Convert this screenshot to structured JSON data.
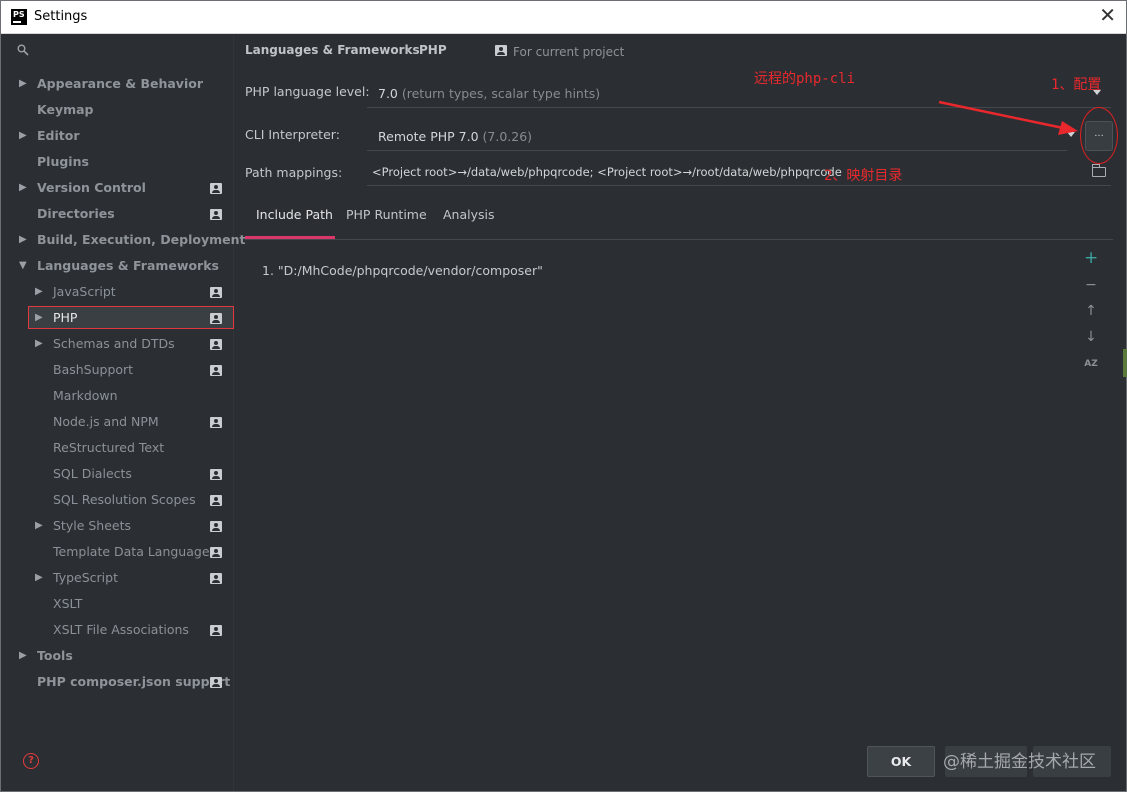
{
  "window": {
    "title": "Settings",
    "app_icon_text": "PS"
  },
  "sidebar": {
    "items": [
      {
        "label": "Appearance & Behavior",
        "level": 0,
        "bold": true,
        "expandable": true,
        "expanded": false,
        "project_icon": false
      },
      {
        "label": "Keymap",
        "level": 0,
        "bold": true,
        "expandable": false,
        "project_icon": false
      },
      {
        "label": "Editor",
        "level": 0,
        "bold": true,
        "expandable": true,
        "expanded": false,
        "project_icon": false
      },
      {
        "label": "Plugins",
        "level": 0,
        "bold": true,
        "expandable": false,
        "project_icon": false
      },
      {
        "label": "Version Control",
        "level": 0,
        "bold": true,
        "expandable": true,
        "expanded": false,
        "project_icon": true
      },
      {
        "label": "Directories",
        "level": 0,
        "bold": true,
        "expandable": false,
        "project_icon": true
      },
      {
        "label": "Build, Execution, Deployment",
        "level": 0,
        "bold": true,
        "expandable": true,
        "expanded": false,
        "project_icon": false
      },
      {
        "label": "Languages & Frameworks",
        "level": 0,
        "bold": true,
        "expandable": true,
        "expanded": true,
        "project_icon": false
      },
      {
        "label": "JavaScript",
        "level": 1,
        "expandable": true,
        "expanded": false,
        "project_icon": true
      },
      {
        "label": "PHP",
        "level": 1,
        "expandable": true,
        "expanded": false,
        "project_icon": true,
        "selected": true
      },
      {
        "label": "Schemas and DTDs",
        "level": 1,
        "expandable": true,
        "expanded": false,
        "project_icon": true
      },
      {
        "label": "BashSupport",
        "level": 1,
        "expandable": false,
        "project_icon": true
      },
      {
        "label": "Markdown",
        "level": 1,
        "expandable": false,
        "project_icon": false
      },
      {
        "label": "Node.js and NPM",
        "level": 1,
        "expandable": false,
        "project_icon": true
      },
      {
        "label": "ReStructured Text",
        "level": 1,
        "expandable": false,
        "project_icon": false
      },
      {
        "label": "SQL Dialects",
        "level": 1,
        "expandable": false,
        "project_icon": true
      },
      {
        "label": "SQL Resolution Scopes",
        "level": 1,
        "expandable": false,
        "project_icon": true
      },
      {
        "label": "Style Sheets",
        "level": 1,
        "expandable": true,
        "expanded": false,
        "project_icon": true
      },
      {
        "label": "Template Data Languages",
        "level": 1,
        "expandable": false,
        "project_icon": true
      },
      {
        "label": "TypeScript",
        "level": 1,
        "expandable": true,
        "expanded": false,
        "project_icon": true
      },
      {
        "label": "XSLT",
        "level": 1,
        "expandable": false,
        "project_icon": false
      },
      {
        "label": "XSLT File Associations",
        "level": 1,
        "expandable": false,
        "project_icon": true
      },
      {
        "label": "Tools",
        "level": 0,
        "bold": true,
        "expandable": true,
        "expanded": false,
        "project_icon": false
      },
      {
        "label": "PHP composer.json support",
        "level": 0,
        "bold": true,
        "expandable": false,
        "project_icon": true
      }
    ]
  },
  "breadcrumb": {
    "parent": "Languages & Frameworks",
    "separator": "›",
    "current": "PHP",
    "scope": "For current project"
  },
  "php_language_level": {
    "label": "PHP language level:",
    "value": "7.0",
    "hint": "(return types, scalar type hints)"
  },
  "cli_interpreter": {
    "label": "CLI Interpreter:",
    "value": "Remote PHP 7.0",
    "hint": "(7.0.26)",
    "browse_label": "..."
  },
  "path_mappings": {
    "label": "Path mappings:",
    "value": "<Project root>→/data/web/phpqrcode; <Project root>→/root/data/web/phpqrcode"
  },
  "tabs": [
    {
      "label": "Include Path",
      "active": true
    },
    {
      "label": "PHP Runtime",
      "active": false
    },
    {
      "label": "Analysis",
      "active": false
    }
  ],
  "include_paths": [
    "1. \"D:/MhCode/phpqrcode/vendor/composer\""
  ],
  "side_tools": {
    "add": "+",
    "remove": "−",
    "up": "↑",
    "down": "↓",
    "sort": "AZ"
  },
  "annotations": {
    "remote_cli": "远程的php-cli",
    "step1": "1、配置",
    "step2": "2、映射目录"
  },
  "footer": {
    "ok_label": "OK",
    "watermark": "@稀土掘金技术社区"
  },
  "colors": {
    "background": "#2b2f33",
    "selection_border": "#e0383e",
    "annotation_red": "#e8282c",
    "tab_accent": "#d9376a",
    "add_green": "#3ba5a0"
  }
}
